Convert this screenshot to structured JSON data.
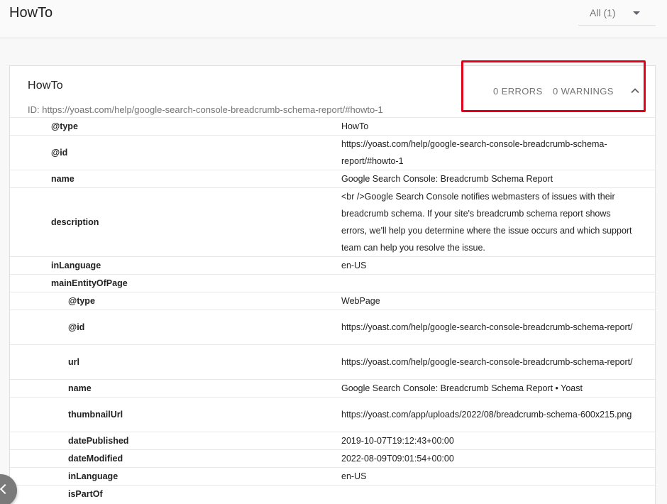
{
  "header": {
    "title": "HowTo",
    "filter_label": "All (1)"
  },
  "card": {
    "title": "HowTo",
    "id_text": "ID: https://yoast.com/help/google-search-console-breadcrumb-schema-report/#howto-1",
    "errors": "0 ERRORS",
    "warnings": "0 WARNINGS"
  },
  "rows": [
    {
      "key": "@type",
      "val": "HowTo",
      "level": 0,
      "h": 25
    },
    {
      "key": "@id",
      "val": "https://yoast.com/help/google-search-console-breadcrumb-schema-report/#howto-1",
      "level": 0,
      "h": 49
    },
    {
      "key": "name",
      "val": "Google Search Console: Breadcrumb Schema Report",
      "level": 0,
      "h": 25
    },
    {
      "key": "description",
      "val": "<br />Google Search Console notifies webmasters of issues with their breadcrumb schema. If your site's breadcrumb schema report shows errors, we'll help you determine where the issue occurs and which support team can help you resolve the issue.",
      "level": 0,
      "h": 97
    },
    {
      "key": "inLanguage",
      "val": "en-US",
      "level": 0,
      "h": 25
    },
    {
      "key": "mainEntityOfPage",
      "val": "",
      "level": 0,
      "h": 25
    },
    {
      "key": "@type",
      "val": "WebPage",
      "level": 1,
      "h": 25
    },
    {
      "key": "@id",
      "val": "https://yoast.com/help/google-search-console-breadcrumb-schema-report/",
      "level": 1,
      "h": 49
    },
    {
      "key": "url",
      "val": "https://yoast.com/help/google-search-console-breadcrumb-schema-report/",
      "level": 1,
      "h": 49
    },
    {
      "key": "name",
      "val": "Google Search Console: Breadcrumb Schema Report • Yoast",
      "level": 1,
      "h": 25
    },
    {
      "key": "thumbnailUrl",
      "val": "https://yoast.com/app/uploads/2022/08/breadcrumb-schema-600x215.png",
      "level": 1,
      "h": 49
    },
    {
      "key": "datePublished",
      "val": "2019-10-07T19:12:43+00:00",
      "level": 1,
      "h": 25
    },
    {
      "key": "dateModified",
      "val": "2022-08-09T09:01:54+00:00",
      "level": 1,
      "h": 25
    },
    {
      "key": "inLanguage",
      "val": "en-US",
      "level": 1,
      "h": 25
    },
    {
      "key": "isPartOf",
      "val": "",
      "level": 1,
      "h": 25
    }
  ],
  "icons": {
    "filter": "dropdown-arrow-icon",
    "collapse": "chevron-up-icon",
    "fab": "chevron-icon"
  }
}
